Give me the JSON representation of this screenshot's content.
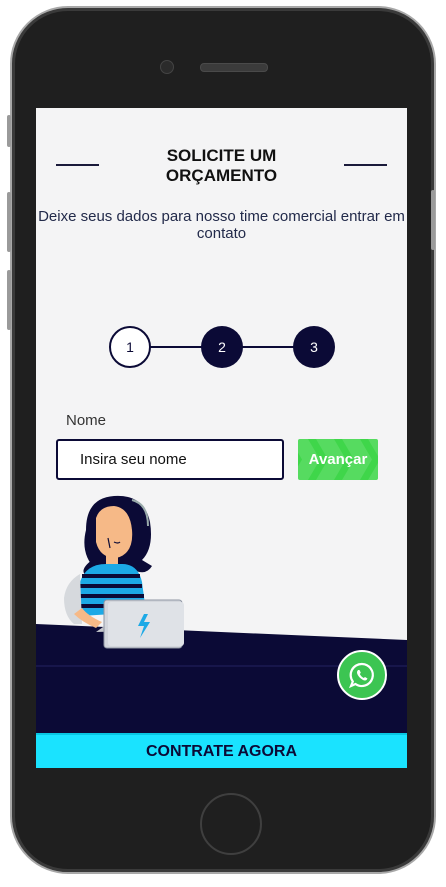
{
  "header": {
    "title": "SOLICITE UM ORÇAMENTO",
    "subtitle": "Deixe seus dados para nosso time comercial entrar em contato"
  },
  "steps": [
    {
      "label": "1",
      "state": "active"
    },
    {
      "label": "2",
      "state": "todo"
    },
    {
      "label": "3",
      "state": "todo"
    }
  ],
  "form": {
    "name_label": "Nome",
    "name_value": "",
    "name_placeholder": "Insira seu nome",
    "advance_label": "Avançar"
  },
  "cta_label": "CONTRATE AGORA",
  "icons": {
    "whatsapp": "whatsapp-icon",
    "illustration": "woman-with-laptop-illustration"
  },
  "colors": {
    "navy": "#0b0a36",
    "green": "#3fd64a",
    "cyan": "#1ae3ff",
    "whatsapp": "#3cc552"
  }
}
